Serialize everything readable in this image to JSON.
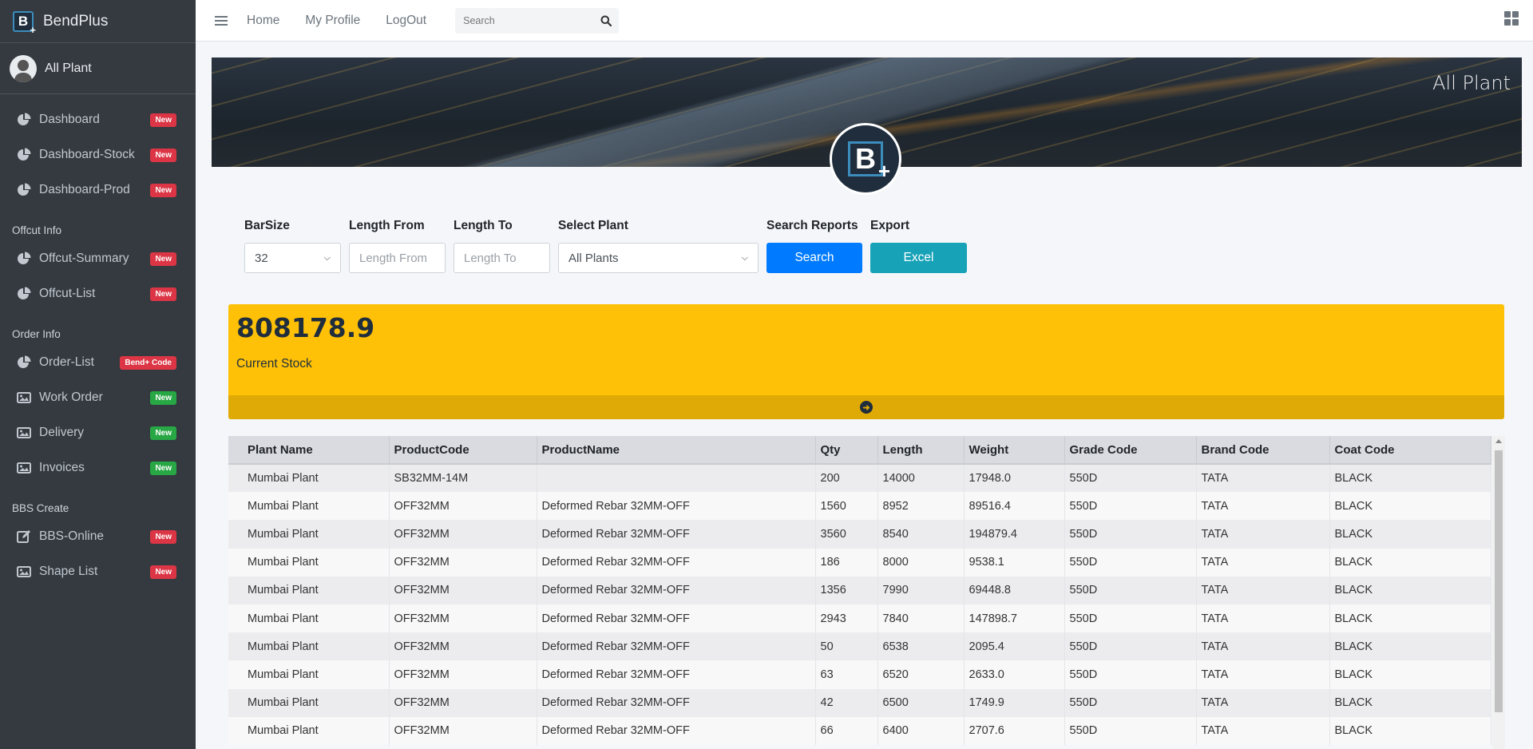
{
  "brand": {
    "name": "BendPlus",
    "logo_letter": "B"
  },
  "user": {
    "name": "All Plant"
  },
  "sidebar": {
    "groups": [
      {
        "header": "",
        "items": [
          {
            "label": "Dashboard",
            "icon": "pie-chart-icon",
            "badge": "New",
            "badge_color": "#dc3545"
          },
          {
            "label": "Dashboard-Stock",
            "icon": "pie-chart-icon",
            "badge": "New",
            "badge_color": "#dc3545"
          },
          {
            "label": "Dashboard-Prod",
            "icon": "pie-chart-icon",
            "badge": "New",
            "badge_color": "#dc3545"
          }
        ]
      },
      {
        "header": "Offcut Info",
        "items": [
          {
            "label": "Offcut-Summary",
            "icon": "pie-chart-icon",
            "badge": "New",
            "badge_color": "#dc3545"
          },
          {
            "label": "Offcut-List",
            "icon": "pie-chart-icon",
            "badge": "New",
            "badge_color": "#dc3545"
          }
        ]
      },
      {
        "header": "Order Info",
        "items": [
          {
            "label": "Order-List",
            "icon": "pie-chart-icon",
            "badge": "Bend+ Code",
            "badge_color": "#dc3545"
          },
          {
            "label": "Work Order",
            "icon": "image-icon",
            "badge": "New",
            "badge_color": "#28a745"
          },
          {
            "label": "Delivery",
            "icon": "image-icon",
            "badge": "New",
            "badge_color": "#28a745"
          },
          {
            "label": "Invoices",
            "icon": "image-icon",
            "badge": "New",
            "badge_color": "#28a745"
          }
        ]
      },
      {
        "header": "BBS Create",
        "items": [
          {
            "label": "BBS-Online",
            "icon": "edit-icon",
            "badge": "New",
            "badge_color": "#dc3545"
          },
          {
            "label": "Shape List",
            "icon": "image-icon",
            "badge": "New",
            "badge_color": "#dc3545"
          }
        ]
      }
    ]
  },
  "navbar": {
    "links": [
      "Home",
      "My Profile",
      "LogOut"
    ],
    "search_placeholder": "Search"
  },
  "hero": {
    "title": "All Plant"
  },
  "filters": {
    "barsize_label": "BarSize",
    "barsize_value": "32",
    "length_from_label": "Length From",
    "length_from_placeholder": "Length From",
    "length_to_label": "Length To",
    "length_to_placeholder": "Length To",
    "plant_label": "Select Plant",
    "plant_value": "All Plants",
    "search_reports_label": "Search Reports",
    "search_button": "Search",
    "export_label": "Export",
    "excel_button": "Excel"
  },
  "stock": {
    "value": "808178.9",
    "label": "Current Stock"
  },
  "table": {
    "columns": [
      "Plant Name",
      "ProductCode",
      "ProductName",
      "Qty",
      "Length",
      "Weight",
      "Grade Code",
      "Brand Code",
      "Coat Code"
    ],
    "rows": [
      [
        "Mumbai Plant",
        "SB32MM-14M",
        "",
        "200",
        "14000",
        "17948.0",
        "550D",
        "TATA",
        "BLACK"
      ],
      [
        "Mumbai Plant",
        "OFF32MM",
        "Deformed Rebar 32MM-OFF",
        "1560",
        "8952",
        "89516.4",
        "550D",
        "TATA",
        "BLACK"
      ],
      [
        "Mumbai Plant",
        "OFF32MM",
        "Deformed Rebar 32MM-OFF",
        "3560",
        "8540",
        "194879.4",
        "550D",
        "TATA",
        "BLACK"
      ],
      [
        "Mumbai Plant",
        "OFF32MM",
        "Deformed Rebar 32MM-OFF",
        "186",
        "8000",
        "9538.1",
        "550D",
        "TATA",
        "BLACK"
      ],
      [
        "Mumbai Plant",
        "OFF32MM",
        "Deformed Rebar 32MM-OFF",
        "1356",
        "7990",
        "69448.8",
        "550D",
        "TATA",
        "BLACK"
      ],
      [
        "Mumbai Plant",
        "OFF32MM",
        "Deformed Rebar 32MM-OFF",
        "2943",
        "7840",
        "147898.7",
        "550D",
        "TATA",
        "BLACK"
      ],
      [
        "Mumbai Plant",
        "OFF32MM",
        "Deformed Rebar 32MM-OFF",
        "50",
        "6538",
        "2095.4",
        "550D",
        "TATA",
        "BLACK"
      ],
      [
        "Mumbai Plant",
        "OFF32MM",
        "Deformed Rebar 32MM-OFF",
        "63",
        "6520",
        "2633.0",
        "550D",
        "TATA",
        "BLACK"
      ],
      [
        "Mumbai Plant",
        "OFF32MM",
        "Deformed Rebar 32MM-OFF",
        "42",
        "6500",
        "1749.9",
        "550D",
        "TATA",
        "BLACK"
      ],
      [
        "Mumbai Plant",
        "OFF32MM",
        "Deformed Rebar 32MM-OFF",
        "66",
        "6400",
        "2707.6",
        "550D",
        "TATA",
        "BLACK"
      ]
    ]
  }
}
